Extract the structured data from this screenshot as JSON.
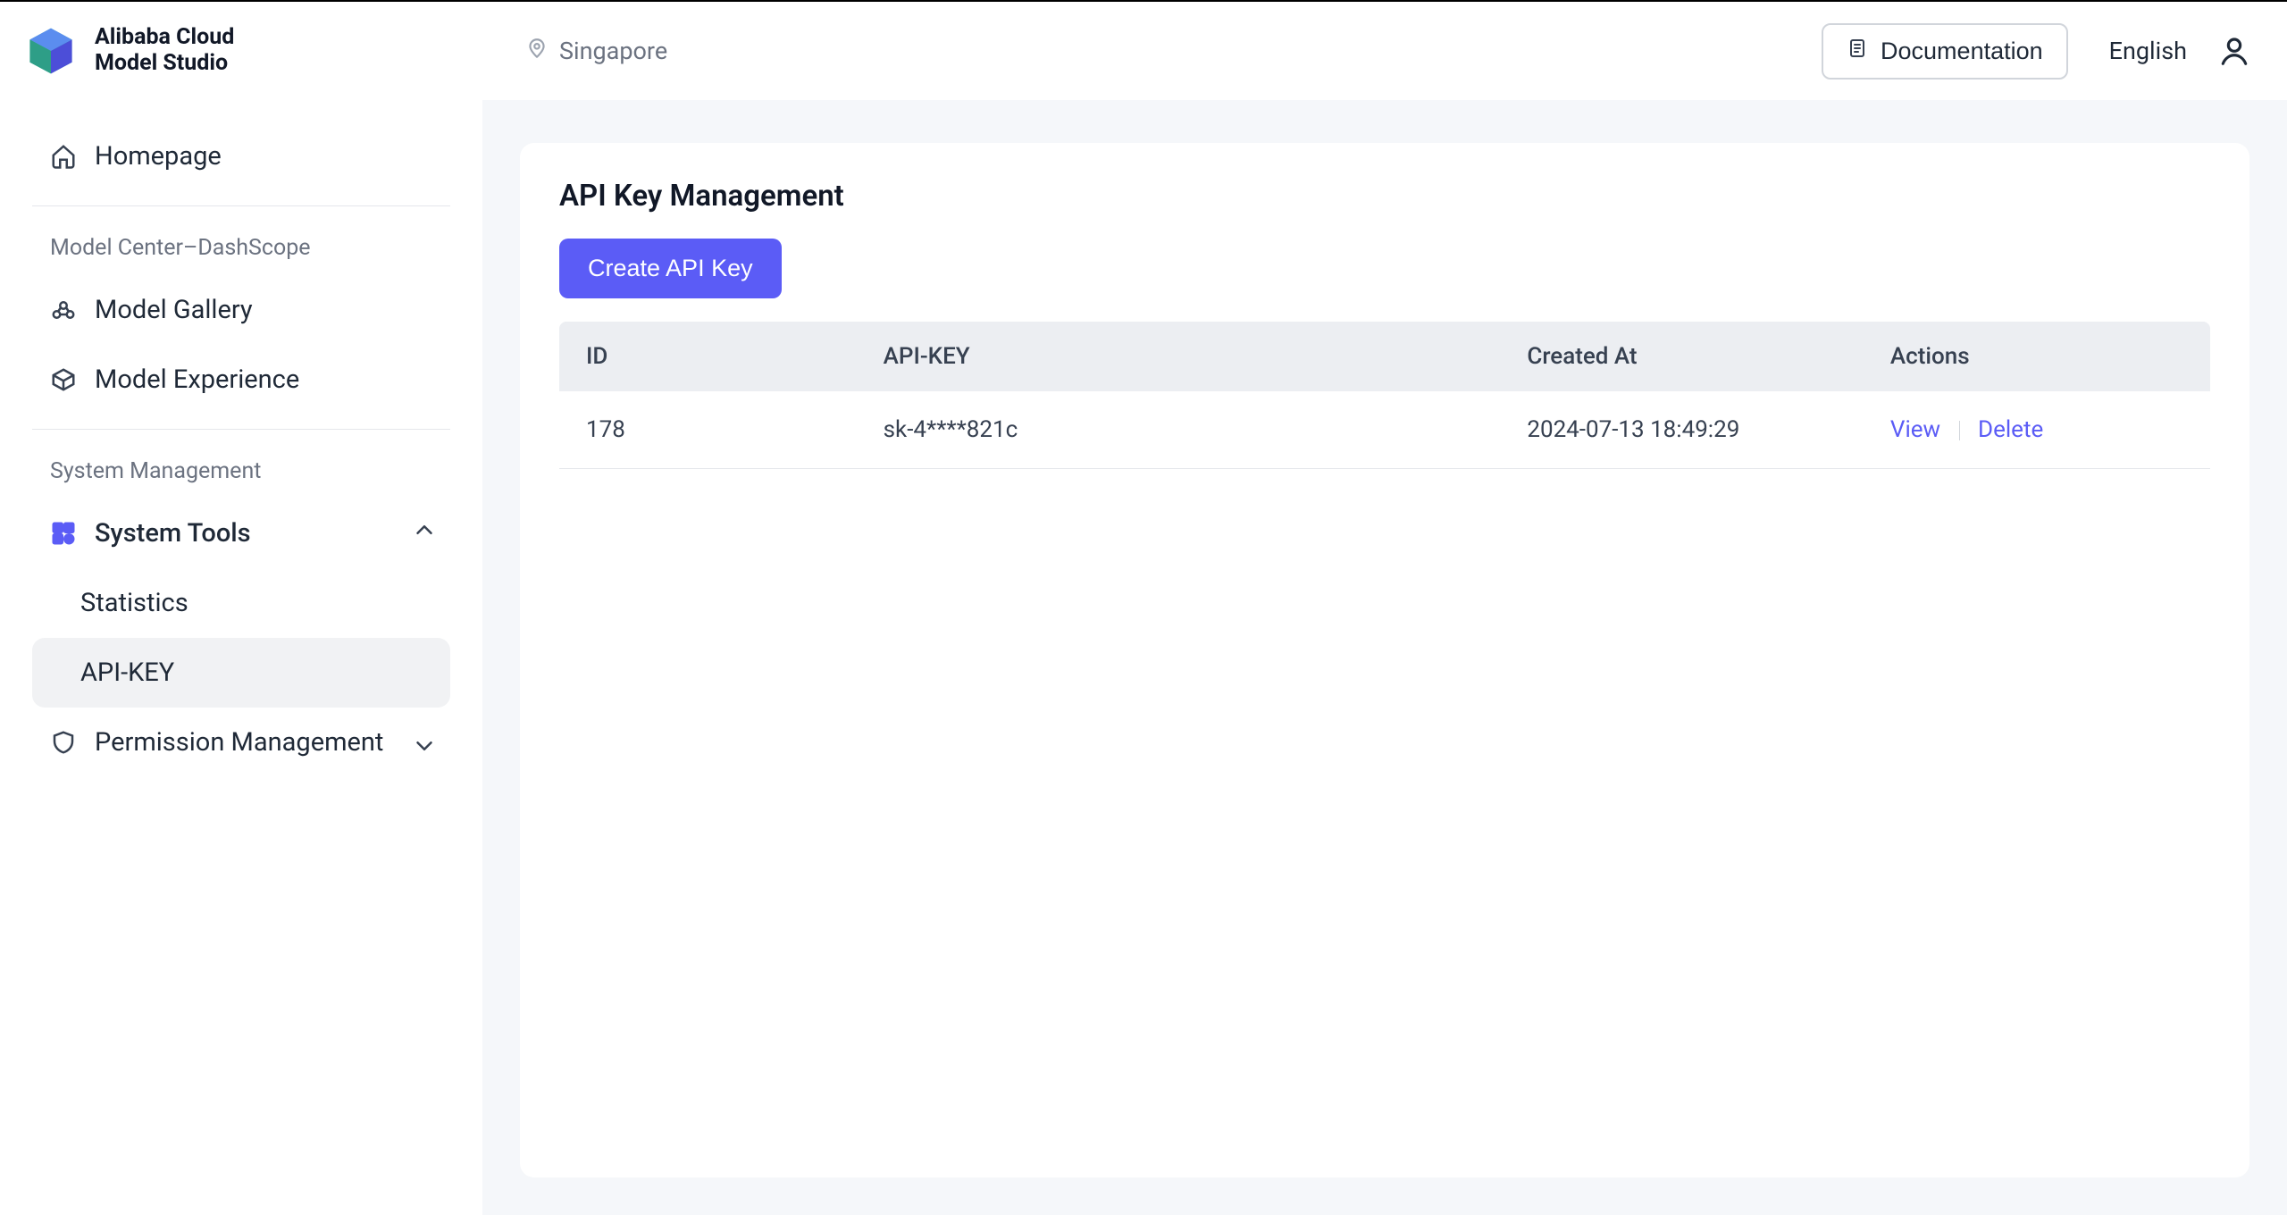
{
  "header": {
    "brand_line1": "Alibaba Cloud",
    "brand_line2": "Model Studio",
    "region": "Singapore",
    "documentation": "Documentation",
    "language": "English"
  },
  "sidebar": {
    "homepage": "Homepage",
    "section1": "Model Center–DashScope",
    "model_gallery": "Model Gallery",
    "model_experience": "Model Experience",
    "section2": "System Management",
    "system_tools": "System Tools",
    "statistics": "Statistics",
    "api_key": "API-KEY",
    "permission_management": "Permission Management"
  },
  "main": {
    "title": "API Key Management",
    "create_button": "Create API Key",
    "columns": {
      "id": "ID",
      "api_key": "API-KEY",
      "created_at": "Created At",
      "actions": "Actions"
    },
    "rows": [
      {
        "id": "178",
        "api_key": "sk-4****821c",
        "created_at": "2024-07-13 18:49:29"
      }
    ],
    "actions": {
      "view": "View",
      "delete": "Delete"
    }
  }
}
